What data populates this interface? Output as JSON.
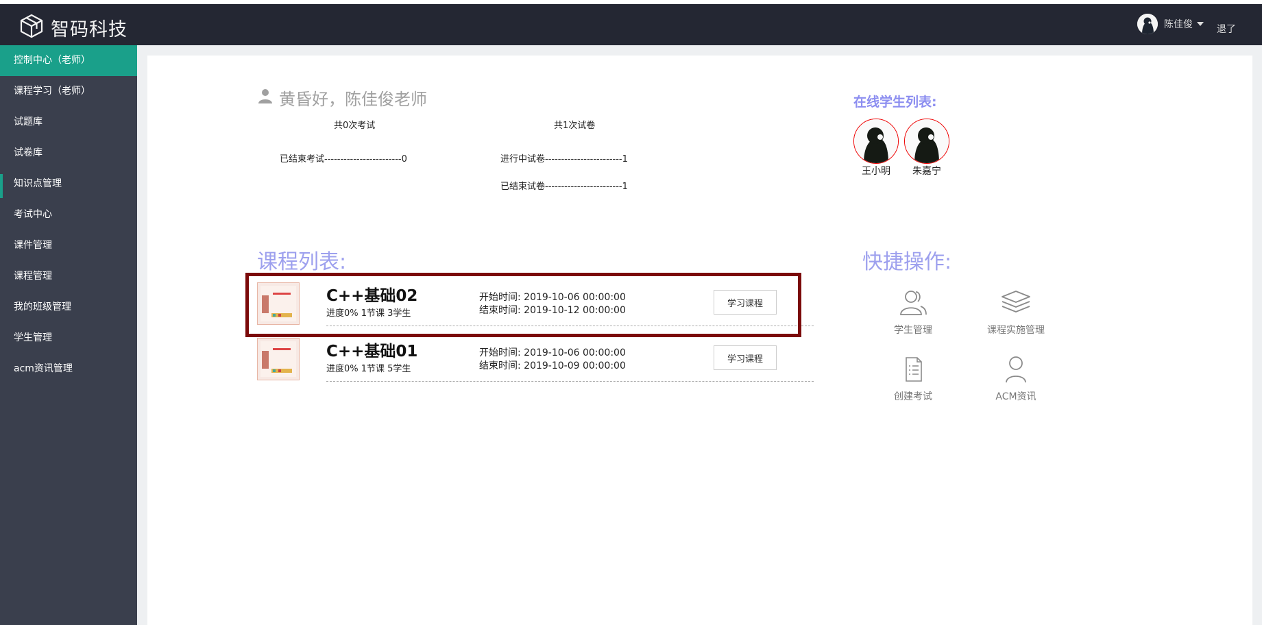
{
  "header": {
    "logo_text": "智码科技",
    "user_name": "陈佳俊",
    "logout_label": "退了"
  },
  "sidebar": {
    "items": [
      {
        "label": "控制中心（老师）"
      },
      {
        "label": "课程学习（老师）"
      },
      {
        "label": "试题库"
      },
      {
        "label": "试卷库"
      },
      {
        "label": "知识点管理"
      },
      {
        "label": "考试中心"
      },
      {
        "label": "课件管理"
      },
      {
        "label": "课程管理"
      },
      {
        "label": "我的班级管理"
      },
      {
        "label": "学生管理"
      },
      {
        "label": "acm资讯管理"
      }
    ]
  },
  "greeting": "黄昏好，陈佳俊老师",
  "stats": {
    "exam_total": "共0次考试",
    "paper_total": "共1次试卷",
    "ended_exam": "已结束考试------------------------0",
    "ongoing_paper": "进行中试卷------------------------1",
    "ended_paper": "已结束试卷------------------------1"
  },
  "online": {
    "title": "在线学生列表:",
    "students": [
      {
        "name": "王小明"
      },
      {
        "name": "朱嘉宁"
      }
    ]
  },
  "courses": {
    "title": "课程列表:",
    "items": [
      {
        "title": "C++基础02",
        "meta": "进度0%  1节课  3学生",
        "start": "开始时间: 2019-10-06 00:00:00",
        "end": "结束时间: 2019-10-12 00:00:00",
        "button": "学习课程"
      },
      {
        "title": "C++基础01",
        "meta": "进度0%  1节课  5学生",
        "start": "开始时间: 2019-10-06 00:00:00",
        "end": "结束时间: 2019-10-09 00:00:00",
        "button": "学习课程"
      }
    ]
  },
  "quick": {
    "title": "快捷操作:",
    "items": [
      {
        "label": "学生管理",
        "icon": "users-icon"
      },
      {
        "label": "课程实施管理",
        "icon": "layers-icon"
      },
      {
        "label": "创建考试",
        "icon": "document-icon"
      },
      {
        "label": "ACM资讯",
        "icon": "person-icon"
      }
    ]
  },
  "colors": {
    "header_bg": "#242733",
    "sidebar_bg": "#3a3f4d",
    "sidebar_active": "#1aa08a",
    "accent_title": "#9da0ee",
    "highlight_border": "#7b0a0a"
  }
}
